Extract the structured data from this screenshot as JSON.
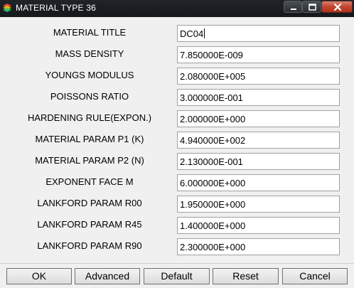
{
  "window": {
    "title": "MATERIAL TYPE 36"
  },
  "fields": [
    {
      "label": "MATERIAL TITLE",
      "value": "DC04"
    },
    {
      "label": "MASS DENSITY",
      "value": "7.850000E-009"
    },
    {
      "label": "YOUNGS MODULUS",
      "value": "2.080000E+005"
    },
    {
      "label": "POISSONS RATIO",
      "value": "3.000000E-001"
    },
    {
      "label": "HARDENING RULE(EXPON.)",
      "value": "2.000000E+000"
    },
    {
      "label": "MATERIAL PARAM P1 (K)",
      "value": "4.940000E+002"
    },
    {
      "label": "MATERIAL PARAM P2 (N)",
      "value": "2.130000E-001"
    },
    {
      "label": "EXPONENT FACE M",
      "value": "6.000000E+000"
    },
    {
      "label": "LANKFORD PARAM R00",
      "value": "1.950000E+000"
    },
    {
      "label": "LANKFORD PARAM R45",
      "value": "1.400000E+000"
    },
    {
      "label": "LANKFORD PARAM R90",
      "value": "2.300000E+000"
    }
  ],
  "buttons": {
    "ok": "OK",
    "advanced": "Advanced",
    "default": "Default",
    "reset": "Reset",
    "cancel": "Cancel"
  }
}
